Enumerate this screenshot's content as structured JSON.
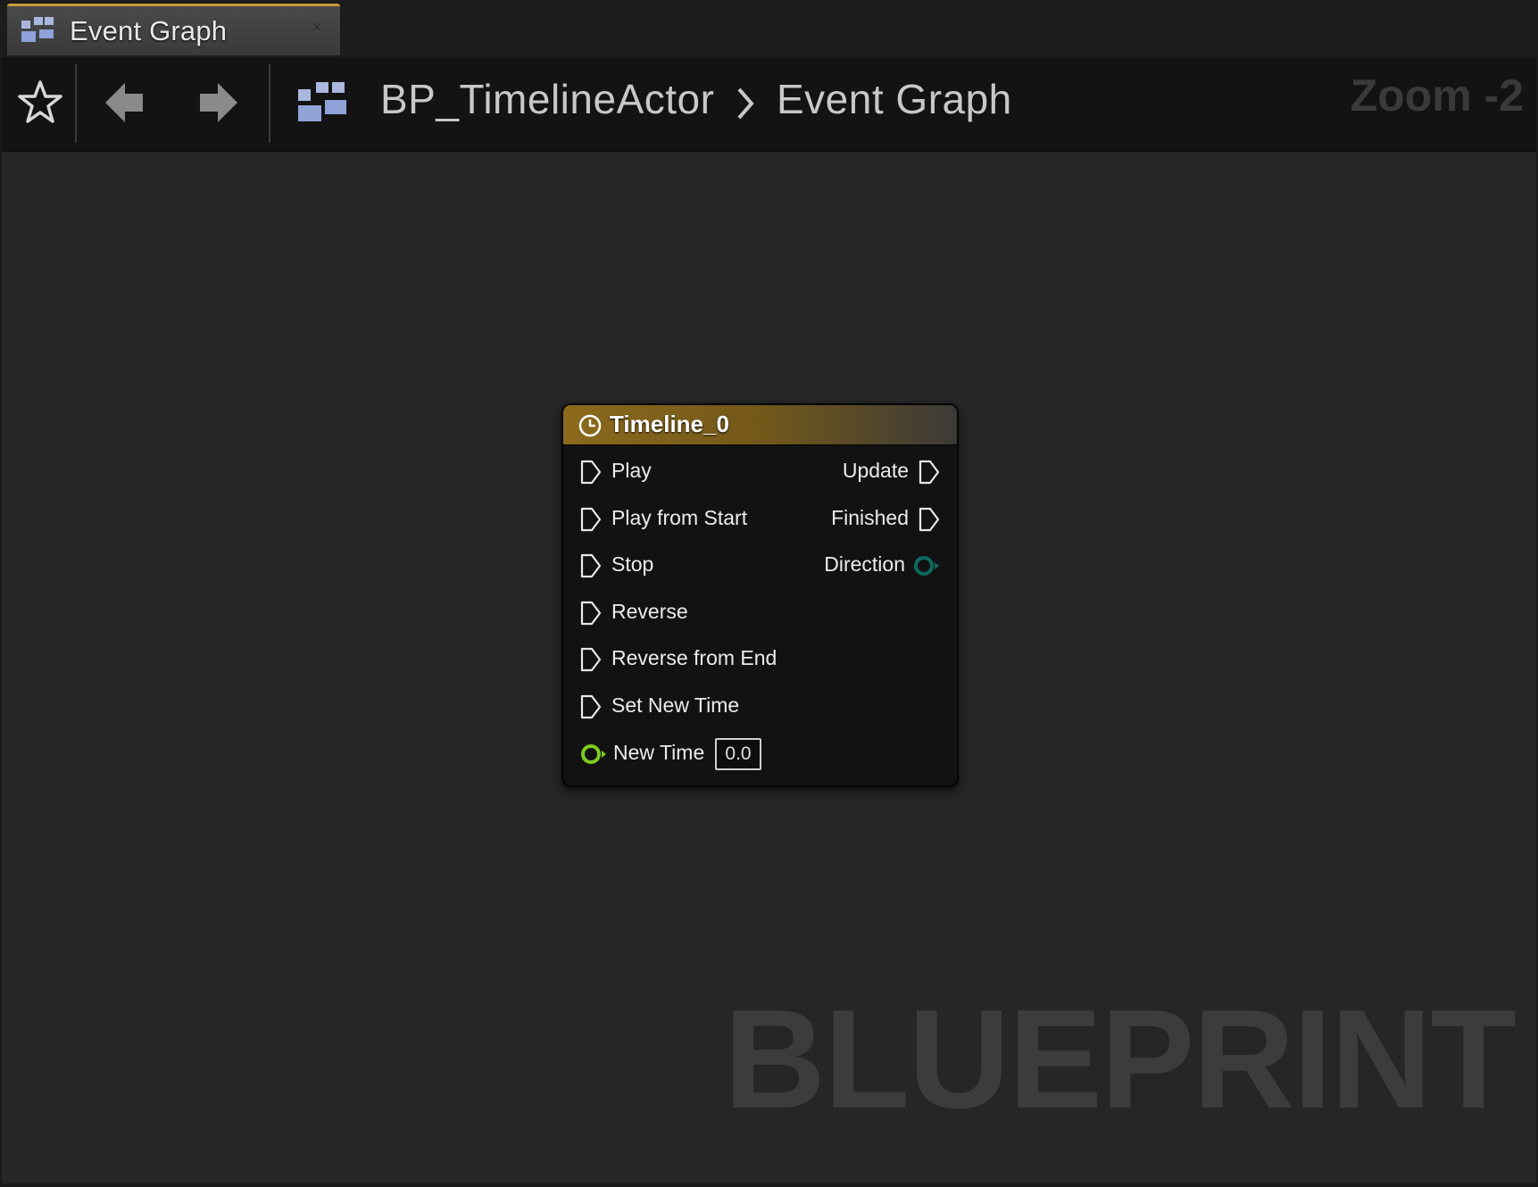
{
  "tab": {
    "label": "Event Graph",
    "close": "×"
  },
  "toolbar": {
    "breadcrumb": [
      "BP_TimelineActor",
      "Event Graph"
    ],
    "zoom": "Zoom -2"
  },
  "graph": {
    "watermark": "BLUEPRINT"
  },
  "node": {
    "title": "Timeline_0",
    "header_color": "#8b6a1d",
    "inputs": [
      "Play",
      "Play from Start",
      "Stop",
      "Reverse",
      "Reverse from End",
      "Set New Time"
    ],
    "outputs": [
      "Update",
      "Finished",
      "Direction"
    ],
    "new_time": {
      "label": "New Time",
      "value": "0.0"
    },
    "colors": {
      "exec": "#e8e8e8",
      "float_pin": "#7ecb1f",
      "enum_pin": "#0d6b5e"
    }
  },
  "icons": [
    "graph-tab-icon",
    "star-icon",
    "back-arrow-icon",
    "forward-arrow-icon",
    "blueprint-graph-icon",
    "chevron-right-icon",
    "clock-icon",
    "exec-pin-icon",
    "data-pin-icon"
  ]
}
